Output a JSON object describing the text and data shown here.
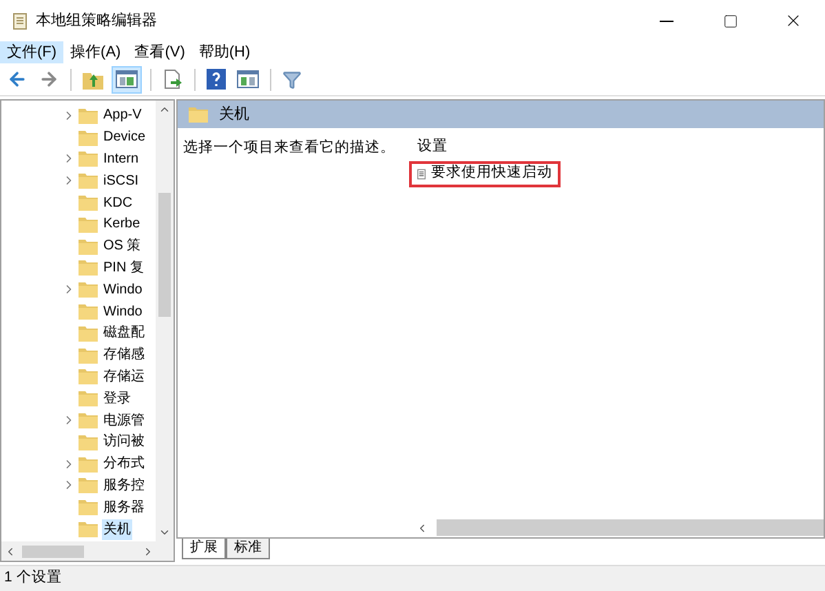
{
  "window": {
    "title": "本地组策略编辑器"
  },
  "menu": [
    {
      "label": "文件(F)",
      "selected": true
    },
    {
      "label": "操作(A)",
      "selected": false
    },
    {
      "label": "查看(V)",
      "selected": false
    },
    {
      "label": "帮助(H)",
      "selected": false
    }
  ],
  "toolbar": [
    {
      "kind": "back"
    },
    {
      "kind": "forward"
    },
    {
      "kind": "sep"
    },
    {
      "kind": "up",
      "pressed": false
    },
    {
      "kind": "tree",
      "pressed": true
    },
    {
      "kind": "sep"
    },
    {
      "kind": "export",
      "pressed": false
    },
    {
      "kind": "sep"
    },
    {
      "kind": "help",
      "pressed": false
    },
    {
      "kind": "view",
      "pressed": false
    },
    {
      "kind": "sep"
    },
    {
      "kind": "filter",
      "pressed": false
    }
  ],
  "tree": [
    {
      "label": "App-V",
      "expandable": true,
      "selected": false
    },
    {
      "label": "Device",
      "expandable": false,
      "selected": false
    },
    {
      "label": "Intern",
      "expandable": true,
      "selected": false
    },
    {
      "label": "iSCSI",
      "expandable": true,
      "selected": false
    },
    {
      "label": "KDC",
      "expandable": false,
      "selected": false
    },
    {
      "label": "Kerbe",
      "expandable": false,
      "selected": false
    },
    {
      "label": "OS 策",
      "expandable": false,
      "selected": false
    },
    {
      "label": "PIN 复",
      "expandable": false,
      "selected": false
    },
    {
      "label": "Windo",
      "expandable": true,
      "selected": false
    },
    {
      "label": "Windo",
      "expandable": false,
      "selected": false
    },
    {
      "label": "磁盘配",
      "expandable": false,
      "selected": false
    },
    {
      "label": "存储感",
      "expandable": false,
      "selected": false
    },
    {
      "label": "存储运",
      "expandable": false,
      "selected": false
    },
    {
      "label": "登录",
      "expandable": false,
      "selected": false
    },
    {
      "label": "电源管",
      "expandable": true,
      "selected": false
    },
    {
      "label": "访问被",
      "expandable": false,
      "selected": false
    },
    {
      "label": "分布式",
      "expandable": true,
      "selected": false
    },
    {
      "label": "服务控",
      "expandable": true,
      "selected": false
    },
    {
      "label": "服务器",
      "expandable": false,
      "selected": false
    },
    {
      "label": "关机",
      "expandable": false,
      "selected": true
    }
  ],
  "details": {
    "header": "关机",
    "description": "选择一个项目来查看它的描述。",
    "column": "设置",
    "settings": [
      {
        "label": "要求使用快速启动",
        "highlighted": true
      }
    ]
  },
  "tabs": [
    {
      "label": "扩展",
      "selected": true
    },
    {
      "label": "标准",
      "selected": false
    }
  ],
  "status_bar": "1 个设置"
}
